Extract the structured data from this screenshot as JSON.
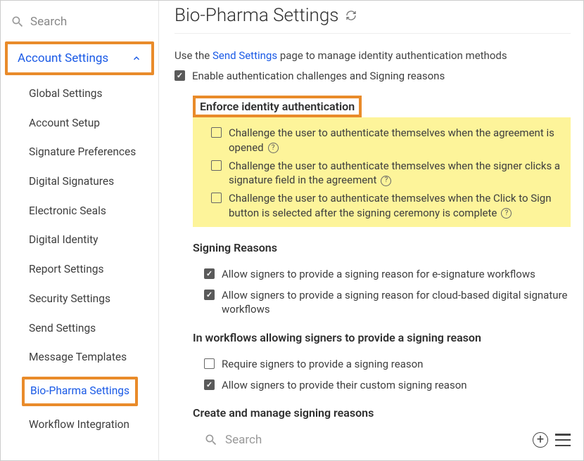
{
  "sidebar": {
    "search_placeholder": "Search",
    "group_label": "Account Settings",
    "items": [
      "Global Settings",
      "Account Setup",
      "Signature Preferences",
      "Digital Signatures",
      "Electronic Seals",
      "Digital Identity",
      "Report Settings",
      "Security Settings",
      "Send Settings",
      "Message Templates",
      "Bio-Pharma Settings",
      "Workflow Integration"
    ],
    "active_index": 10
  },
  "page": {
    "title": "Bio-Pharma Settings",
    "intro_prefix": "Use the ",
    "intro_link": "Send Settings",
    "intro_suffix": " page to manage identity authentication methods",
    "enable_challenges": {
      "checked": true,
      "label": "Enable authentication challenges and Signing reasons"
    },
    "enforce": {
      "heading": "Enforce identity authentication",
      "items": [
        {
          "checked": false,
          "label": "Challenge the user to authenticate themselves when the agreement is opened",
          "help": true
        },
        {
          "checked": false,
          "label": "Challenge the user to authenticate themselves when the signer clicks a signature field in the agreement",
          "help": true
        },
        {
          "checked": false,
          "label": "Challenge the user to authenticate themselves when the Click to Sign button is selected after the signing ceremony is complete",
          "help": true
        }
      ]
    },
    "signing_reasons": {
      "heading": "Signing Reasons",
      "items": [
        {
          "checked": true,
          "label": "Allow signers to provide a signing reason for e-signature workflows"
        },
        {
          "checked": true,
          "label": "Allow signers to provide a signing reason for cloud-based digital signature workflows"
        }
      ]
    },
    "workflows": {
      "heading": "In workflows allowing signers to provide a signing reason",
      "items": [
        {
          "checked": false,
          "label": "Require signers to provide a signing reason"
        },
        {
          "checked": true,
          "label": "Allow signers to provide their custom signing reason"
        }
      ]
    },
    "create_manage": {
      "heading": "Create and manage signing reasons",
      "search_placeholder": "Search"
    }
  }
}
